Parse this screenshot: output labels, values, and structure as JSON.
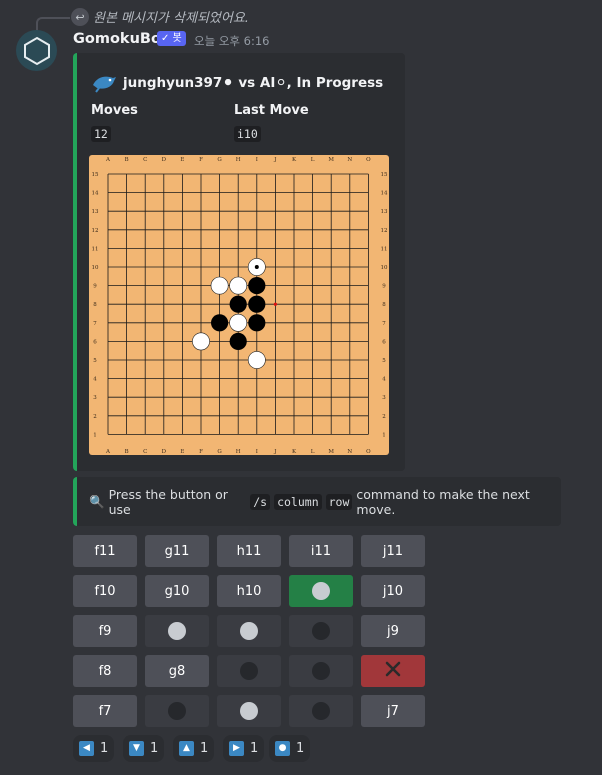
{
  "reply": {
    "text": "원본 메시지가 삭제되었어요."
  },
  "author": {
    "name": "GomokuBot",
    "bot_tag": "✓ 봇",
    "timestamp": "오늘 오후 6:16"
  },
  "embed": {
    "title": "junghyun397⚫ vs AI⚪, In Progress",
    "fields": [
      {
        "name": "Moves",
        "value": "12"
      },
      {
        "name": "Last Move",
        "value": "i10"
      }
    ],
    "accent_color": "#23a55a"
  },
  "board": {
    "columns": [
      "A",
      "B",
      "C",
      "D",
      "E",
      "F",
      "G",
      "H",
      "I",
      "J",
      "K",
      "L",
      "M",
      "N",
      "O"
    ],
    "rows": [
      "15",
      "14",
      "13",
      "12",
      "11",
      "10",
      "9",
      "8",
      "7",
      "6",
      "5",
      "4",
      "3",
      "2",
      "1"
    ],
    "board_color": "#f2b673",
    "black_stones": [
      "i9",
      "h8",
      "i8",
      "g7",
      "i7",
      "h6"
    ],
    "white_stones": [
      "i10",
      "g9",
      "h9",
      "h7",
      "f6",
      "i5"
    ],
    "last_move": "i10",
    "marker": "j8"
  },
  "note": {
    "icon": "🔍",
    "text_before": "Press the button or use",
    "cmd1": "/s",
    "cmd2": "column",
    "cmd3": "row",
    "text_after": "command to make the next move."
  },
  "buttons": [
    [
      {
        "label": "f11"
      },
      {
        "label": "g11"
      },
      {
        "label": "h11"
      },
      {
        "label": "i11"
      },
      {
        "label": "j11"
      }
    ],
    [
      {
        "label": "f10"
      },
      {
        "label": "g10"
      },
      {
        "label": "h10"
      },
      {
        "stone": "white",
        "style": "green"
      },
      {
        "label": "j10"
      }
    ],
    [
      {
        "label": "f9"
      },
      {
        "stone": "white"
      },
      {
        "stone": "white"
      },
      {
        "stone": "black"
      },
      {
        "label": "j9"
      }
    ],
    [
      {
        "label": "f8"
      },
      {
        "label": "g8"
      },
      {
        "stone": "black"
      },
      {
        "stone": "black"
      },
      {
        "icon": "close-icon",
        "style": "red"
      }
    ],
    [
      {
        "label": "f7"
      },
      {
        "stone": "black"
      },
      {
        "stone": "white"
      },
      {
        "stone": "black"
      },
      {
        "label": "j7"
      }
    ]
  ],
  "reactions": [
    {
      "icon": "◀",
      "count": "1",
      "name": "left-arrow"
    },
    {
      "icon": "▼",
      "count": "1",
      "name": "down-arrow"
    },
    {
      "icon": "▲",
      "count": "1",
      "name": "up-arrow"
    },
    {
      "icon": "▶",
      "count": "1",
      "name": "right-arrow"
    },
    {
      "icon": "●",
      "count": "1",
      "name": "record-button"
    }
  ]
}
